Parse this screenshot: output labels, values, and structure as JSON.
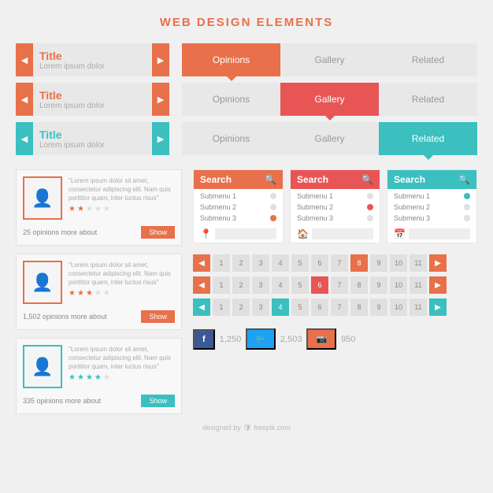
{
  "page": {
    "title": "WEB DESIGN ELEMENTS"
  },
  "title_bars": [
    {
      "id": "bar1",
      "color": "orange",
      "title": "Title",
      "subtitle": "Lorem ipsum dolor"
    },
    {
      "id": "bar2",
      "color": "orange",
      "title": "Title",
      "subtitle": "Lorem ipsum dolor"
    },
    {
      "id": "bar3",
      "color": "teal",
      "title": "Title",
      "subtitle": "Lorem ipsum dolor"
    }
  ],
  "tab_rows": [
    {
      "tabs": [
        {
          "label": "Opinions",
          "state": "active-orange"
        },
        {
          "label": "Gallery",
          "state": "inactive"
        },
        {
          "label": "Related",
          "state": "inactive"
        }
      ]
    },
    {
      "tabs": [
        {
          "label": "Opinions",
          "state": "inactive"
        },
        {
          "label": "Gallery",
          "state": "active-red"
        },
        {
          "label": "Related",
          "state": "inactive"
        }
      ]
    },
    {
      "tabs": [
        {
          "label": "Opinions",
          "state": "inactive"
        },
        {
          "label": "Gallery",
          "state": "inactive"
        },
        {
          "label": "Related",
          "state": "active-teal"
        }
      ]
    }
  ],
  "opinion_cards": [
    {
      "text": "\"Lorem ipsum dolor sit amet, consectetur adipiscing elit. Nam quis porttitor quam, inter luctus risus\"",
      "stars": [
        1,
        1,
        0,
        0,
        0
      ],
      "count": "25 opinions more about",
      "btn": "Show",
      "color": "orange"
    },
    {
      "text": "\"Lorem ipsum dolor sit amet, consectetur adipiscing elit. Nam quis porttitor quam, inter luctus risus\"",
      "stars": [
        1,
        1,
        1,
        0,
        0
      ],
      "count": "1,502 opinions more about",
      "btn": "Show",
      "color": "orange"
    },
    {
      "text": "\"Lorem ipsum dolor sit amet, consectetur adipiscing elit. Nam quis porttitor quam, inter luctus risus\"",
      "stars": [
        1,
        1,
        1,
        1,
        0
      ],
      "count": "335 opinions more about",
      "btn": "Show",
      "color": "teal"
    }
  ],
  "search_panels": [
    {
      "title": "Search",
      "color": "orange",
      "items": [
        "Submenu 1",
        "Submenu 2",
        "Submenu 3"
      ],
      "dots": [
        "empty",
        "empty",
        "orange"
      ],
      "icon": "🔍",
      "input_icon": "📍"
    },
    {
      "title": "Search",
      "color": "red",
      "items": [
        "Submenu 1",
        "Submenu 2",
        "Submenu 3"
      ],
      "dots": [
        "empty",
        "red",
        "empty"
      ],
      "icon": "🔍",
      "input_icon": "🏠"
    },
    {
      "title": "Search",
      "color": "teal",
      "items": [
        "Submenu 1",
        "Submenu 2",
        "Submenu 3"
      ],
      "dots": [
        "teal",
        "empty",
        "empty"
      ],
      "icon": "🔍",
      "input_icon": "📅"
    }
  ],
  "pagination_rows": [
    {
      "color": "orange",
      "active": 8,
      "numbers": [
        1,
        2,
        3,
        4,
        5,
        6,
        7,
        8,
        9,
        10,
        11
      ]
    },
    {
      "color": "red",
      "active": 6,
      "numbers": [
        1,
        2,
        3,
        4,
        5,
        6,
        7,
        8,
        9,
        10,
        11
      ]
    },
    {
      "color": "teal",
      "active": 4,
      "numbers": [
        1,
        2,
        3,
        4,
        5,
        6,
        7,
        8,
        9,
        10,
        11
      ]
    }
  ],
  "social": [
    {
      "icon": "f",
      "color": "fb",
      "count": "1,250"
    },
    {
      "icon": "🐦",
      "color": "tw",
      "count": "2,503"
    },
    {
      "icon": "📷",
      "color": "ig",
      "count": "950"
    }
  ],
  "footer": "designed by 🛡 freepik.com",
  "labels": {
    "search": "Search",
    "show": "Show",
    "opinions": "Opinions",
    "gallery": "Gallery",
    "related": "Related",
    "title": "Title"
  }
}
